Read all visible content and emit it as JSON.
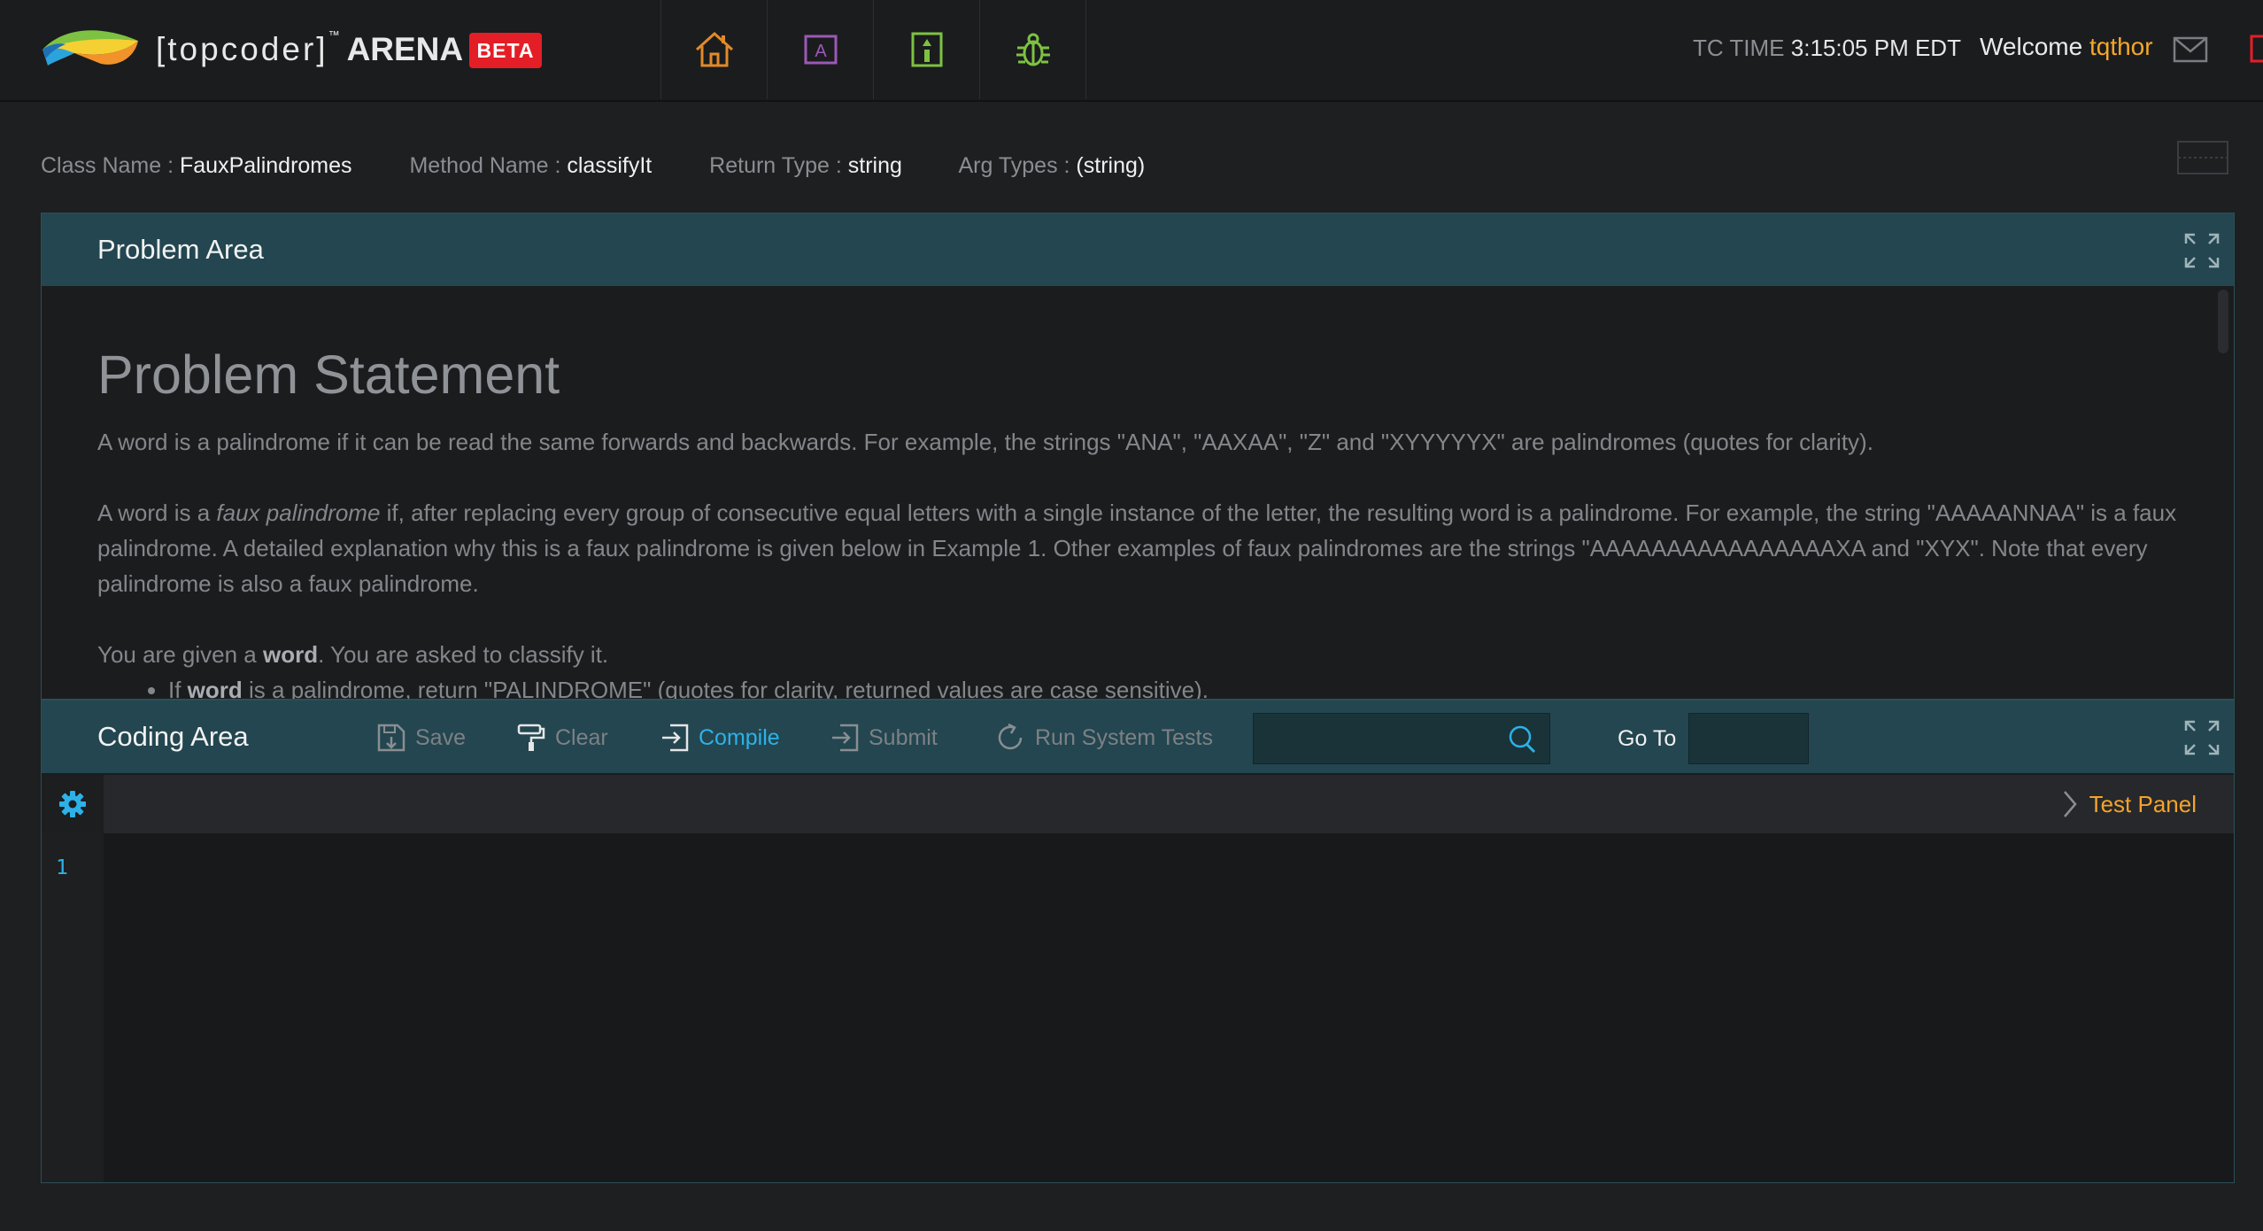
{
  "header": {
    "brand_bracket": "[topcoder]",
    "brand_tm": "™",
    "brand_arena": "ARENA",
    "beta": "BETA",
    "nav": [
      "home-icon",
      "active-contests-icon",
      "practice-rooms-icon",
      "bug-report-icon"
    ],
    "tc_time_label": "TC TIME",
    "tc_time_value": "3:15:05 PM EDT",
    "welcome_label": "Welcome",
    "username": "tqthor",
    "colors": {
      "accent_orange": "#f4a82a",
      "beta_red": "#e41e26",
      "compile_blue": "#2cb2e8"
    }
  },
  "meta": {
    "class_name_label": "Class Name :",
    "class_name": "FauxPalindromes",
    "method_name_label": "Method Name :",
    "method_name": "classifyIt",
    "return_type_label": "Return Type :",
    "return_type": "string",
    "arg_types_label": "Arg Types :",
    "arg_types": "(string)"
  },
  "problem": {
    "panel_title": "Problem Area",
    "heading": "Problem Statement",
    "p1": "A word is a palindrome if it can be read the same forwards and backwards. For example, the strings \"ANA\", \"AAXAA\", \"Z\" and \"XYYYYYX\" are palindromes (quotes for clarity).",
    "p2_a": "A word is a ",
    "p2_em": "faux palindrome",
    "p2_b": " if, after replacing every group of consecutive equal letters with a single instance of the letter, the resulting word is a palindrome. For example, the string \"AAAAANNAA\" is a faux palindrome. A detailed explanation why this is a faux palindrome is given below in Example 1. Other examples of faux palindromes are the strings \"AAAAAAAAAAAAAAAAXA and \"XYX\". Note that every palindrome is also a faux palindrome.",
    "p3_a": "You are given a ",
    "p3_b": "word",
    "p3_c": ". You are asked to classify it.",
    "li1_a": "If ",
    "li1_b": "word",
    "li1_c": " is a palindrome, return \"PALINDROME\" (quotes for clarity, returned values are case sensitive)."
  },
  "coding": {
    "panel_title": "Coding Area",
    "save": "Save",
    "clear": "Clear",
    "compile": "Compile",
    "submit": "Submit",
    "run_tests": "Run System Tests",
    "search_placeholder": "",
    "goto_label": "Go To",
    "goto_value": "",
    "test_panel": "Test Panel",
    "line_numbers": [
      "1"
    ]
  }
}
